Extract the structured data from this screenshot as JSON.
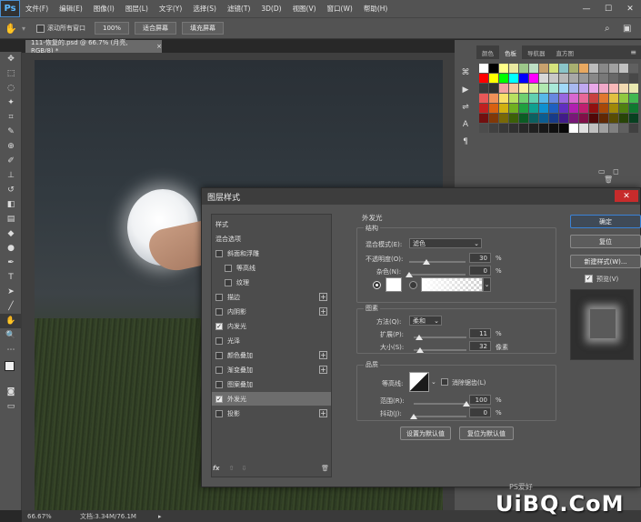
{
  "menubar": {
    "logo": "Ps",
    "items": [
      "文件(F)",
      "编辑(E)",
      "图像(I)",
      "图层(L)",
      "文字(Y)",
      "选择(S)",
      "滤镜(T)",
      "3D(D)",
      "视图(V)",
      "窗口(W)",
      "帮助(H)"
    ],
    "minimize": "—",
    "maximize": "☐",
    "close": "✕"
  },
  "options": {
    "scroll_all_label": "滚动所有窗口",
    "zoom_value": "100%",
    "fit_screen": "适合屏幕",
    "fill_screen": "填充屏幕"
  },
  "document": {
    "tab_title": "111-恢复的.psd @ 66.7% (月亮, RGB/8) *",
    "tab_close": "×"
  },
  "status": {
    "zoom": "66.67%",
    "doc_info": "文档:3.34M/76.1M",
    "arrow": "▸"
  },
  "panel": {
    "tabs": [
      "颜色",
      "色板",
      "导航器",
      "直方图"
    ],
    "active_tab": "色板",
    "swatch_colors": [
      "#ffffff",
      "#000000",
      "#ffff88",
      "#e8e8a0",
      "#9dc88a",
      "#bde0c4",
      "#c8a26e",
      "#d4e27c",
      "#8ac4c8",
      "#a8b070",
      "#e8a860",
      "#bcbcbc",
      "#888888",
      "#a0a0a0",
      "#c0c0c0",
      "#606060",
      "#ff0000",
      "#ffff00",
      "#00ff00",
      "#00ffff",
      "#0000ff",
      "#ff00ff",
      "#d8d8d8",
      "#c8c8c8",
      "#b8b8b8",
      "#a8a8a8",
      "#989898",
      "#888888",
      "#787878",
      "#686868",
      "#585858",
      "#484848",
      "#3a3a3a",
      "#303030",
      "#f4a4a4",
      "#f8c8a0",
      "#fcf0a0",
      "#d8f0a0",
      "#b0e8b0",
      "#a8e8d8",
      "#a0d8f8",
      "#a8b8f0",
      "#c0a8f0",
      "#e8a8e8",
      "#f0a8c8",
      "#f8b8b8",
      "#f0d8b0",
      "#e8e8b0",
      "#e85858",
      "#f09058",
      "#f8e068",
      "#b8e060",
      "#70d070",
      "#60d0b0",
      "#58b8e8",
      "#6888e0",
      "#9868e0",
      "#d868d0",
      "#e86898",
      "#c84040",
      "#e07830",
      "#e0c040",
      "#90c840",
      "#40b850",
      "#c02020",
      "#d86010",
      "#d0b010",
      "#70b020",
      "#20a040",
      "#10a090",
      "#1090d0",
      "#2060c0",
      "#6030c0",
      "#b020b0",
      "#c02070",
      "#901010",
      "#a84808",
      "#a08808",
      "#508010",
      "#107830",
      "#701010",
      "#803808",
      "#786808",
      "#3c6008",
      "#0c5c24",
      "#0c6060",
      "#0c5c90",
      "#183c88",
      "#401c88",
      "#781878",
      "#801048",
      "#500808",
      "#602804",
      "#584c04",
      "#284408",
      "#084020",
      "#4c4c4c",
      "#404040",
      "#383838",
      "#303030",
      "#282828",
      "#202020",
      "#181818",
      "#101010",
      "#080808",
      "#ffffff",
      "#e0e0e0",
      "#c0c0c0",
      "#a0a0a0",
      "#808080",
      "#606060",
      "#404040"
    ],
    "footer_icons": [
      "folder-icon",
      "new-icon",
      "trash-icon"
    ]
  },
  "dialog": {
    "title": "图层样式",
    "close": "✕",
    "styles_header": "样式",
    "blend_options": "混合选项",
    "style_items": [
      {
        "label": "斜面和浮雕",
        "checked": false,
        "plus": false
      },
      {
        "label": "等高线",
        "checked": false,
        "plus": false,
        "indent": true
      },
      {
        "label": "纹理",
        "checked": false,
        "plus": false,
        "indent": true
      },
      {
        "label": "描边",
        "checked": false,
        "plus": true
      },
      {
        "label": "内阴影",
        "checked": false,
        "plus": true
      },
      {
        "label": "内发光",
        "checked": true,
        "plus": false
      },
      {
        "label": "光泽",
        "checked": false,
        "plus": false
      },
      {
        "label": "颜色叠加",
        "checked": false,
        "plus": true
      },
      {
        "label": "渐变叠加",
        "checked": false,
        "plus": true
      },
      {
        "label": "图案叠加",
        "checked": false,
        "plus": false
      },
      {
        "label": "外发光",
        "checked": true,
        "plus": false,
        "selected": true
      },
      {
        "label": "投影",
        "checked": false,
        "plus": true
      }
    ],
    "list_footer": {
      "fx": "fx",
      "up": "⇧",
      "down": "⇩",
      "trash": "🗑"
    },
    "section_title": "外发光",
    "structure": {
      "title": "结构",
      "blend_mode_label": "混合模式(E):",
      "blend_mode": "滤色",
      "opacity_label": "不透明度(O):",
      "opacity": "30",
      "opacity_value": 30,
      "noise_label": "杂色(N):",
      "noise": "0",
      "noise_value": 0,
      "percent": "%"
    },
    "elements": {
      "title": "图素",
      "method_label": "方法(Q):",
      "method": "柔和",
      "spread_label": "扩展(P):",
      "spread": "11",
      "spread_value": 11,
      "size_label": "大小(S):",
      "size": "32",
      "size_value": 32,
      "px": "像素",
      "percent": "%"
    },
    "quality": {
      "title": "品质",
      "contour_label": "等高线:",
      "anti_alias_label": "消除锯齿(L)",
      "range_label": "范围(R):",
      "range": "100",
      "range_value": 100,
      "jitter_label": "抖动(J):",
      "jitter": "0",
      "jitter_value": 0,
      "percent": "%"
    },
    "set_default": "设置为默认值",
    "reset_default": "复位为默认值",
    "buttons": {
      "ok": "确定",
      "reset": "复位",
      "new_style": "新建样式(W)...",
      "preview": "预览(V)"
    }
  },
  "watermark": {
    "text": "UiBQ.CoM",
    "small": "PS爱好"
  }
}
